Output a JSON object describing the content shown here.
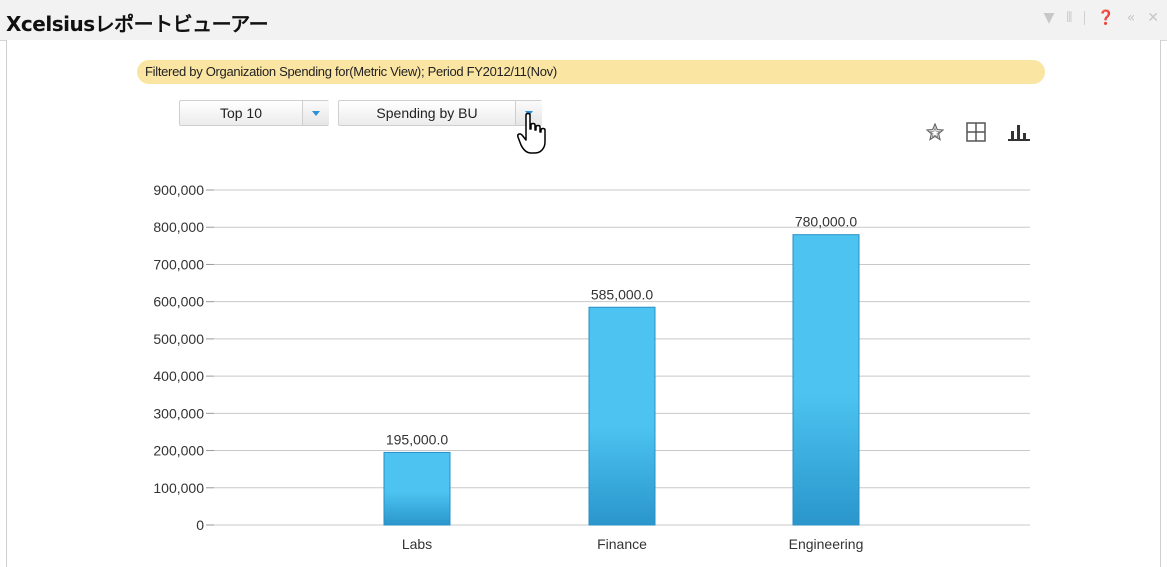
{
  "window": {
    "title": "Xcelsiusレポートビューアー"
  },
  "filter": {
    "text": "Filtered by Organization Spending for(Metric View); Period FY2012/11(Nov)"
  },
  "controls": {
    "top_select": "Top 10",
    "view_select": "Spending by BU"
  },
  "icons": [
    "filter-icon",
    "pin-icon",
    "help-icon",
    "collapse-icon",
    "close-icon",
    "star-icon",
    "grid-icon",
    "bar-chart-icon",
    "hand-cursor-icon"
  ],
  "colors": {
    "bar_top": "#4cc3f0",
    "bar_bottom": "#2a96cc",
    "filter_bg": "#fbe5a3",
    "accent": "#2d8fd6"
  },
  "chart_data": {
    "type": "bar",
    "categories": [
      "Labs",
      "Finance",
      "Engineering"
    ],
    "values": [
      195000,
      585000,
      780000
    ],
    "data_labels": [
      "195,000.0",
      "585,000.0",
      "780,000.0"
    ],
    "ylim": [
      0,
      900000
    ],
    "yticks": [
      0,
      100000,
      200000,
      300000,
      400000,
      500000,
      600000,
      700000,
      800000,
      900000
    ],
    "ytick_labels": [
      "0",
      "100,000",
      "200,000",
      "300,000",
      "400,000",
      "500,000",
      "600,000",
      "700,000",
      "800,000",
      "900,000"
    ],
    "grid": true,
    "title": "",
    "xlabel": "",
    "ylabel": ""
  }
}
